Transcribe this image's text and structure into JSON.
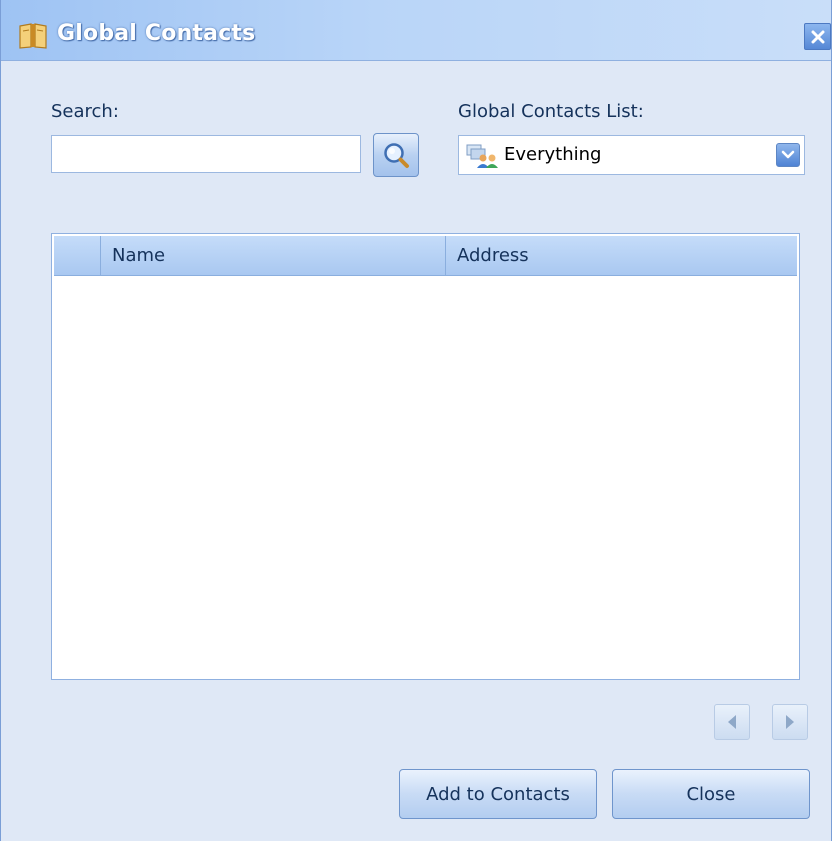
{
  "window": {
    "title": "Global Contacts",
    "icon": "book-icon",
    "close_icon": "close-icon"
  },
  "search": {
    "label": "Search:",
    "value": "",
    "placeholder": "",
    "button_icon": "magnifier-icon"
  },
  "contacts_list": {
    "label": "Global Contacts List:",
    "selected": "Everything",
    "icon": "contacts-group-icon"
  },
  "table": {
    "columns": [
      "Name",
      "Address"
    ],
    "rows": []
  },
  "pager": {
    "prev_icon": "arrow-left-icon",
    "next_icon": "arrow-right-icon"
  },
  "actions": {
    "add_label": "Add to Contacts",
    "close_label": "Close"
  },
  "colors": {
    "window_bg": "#dfe8f6",
    "title_text": "#ffffff",
    "label_text": "#15325b",
    "accent": "#5688d6"
  }
}
